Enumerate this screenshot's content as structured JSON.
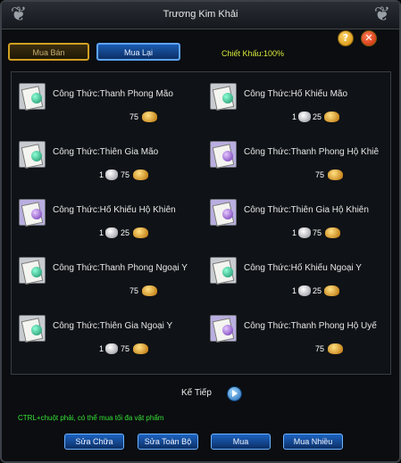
{
  "window": {
    "title": "Trương Kim Khải"
  },
  "tabs": [
    {
      "label": "Mua Bán",
      "active": true
    },
    {
      "label": "Mua Lại",
      "active": false
    }
  ],
  "discount_text": "Chiết Khấu:100%",
  "header_buttons": {
    "help": "?",
    "close": "✕"
  },
  "items": [
    {
      "name": "Công Thức:Thanh Phong Mão",
      "icon": "recipe-scroll-green-icon",
      "silver": null,
      "gold": "75"
    },
    {
      "name": "Công Thức:Hổ Khiếu Mão",
      "icon": "recipe-scroll-green-icon",
      "silver": "1",
      "gold": "25"
    },
    {
      "name": "Công Thức:Thiên Gia Mão",
      "icon": "recipe-scroll-green-icon",
      "silver": "1",
      "gold": "75"
    },
    {
      "name": "Công Thức:Thanh Phong Hộ Khiê",
      "icon": "recipe-scroll-purple-icon",
      "silver": null,
      "gold": "75"
    },
    {
      "name": "Công Thức:Hổ Khiếu Hộ Khiên",
      "icon": "recipe-scroll-purple-icon",
      "silver": "1",
      "gold": "25"
    },
    {
      "name": "Công Thức:Thiên Gia Hộ Khiên",
      "icon": "recipe-scroll-purple-icon",
      "silver": "1",
      "gold": "75"
    },
    {
      "name": "Công Thức:Thanh Phong Ngoại Y",
      "icon": "recipe-scroll-green-icon",
      "silver": null,
      "gold": "75"
    },
    {
      "name": "Công Thức:Hổ Khiếu Ngoại Y",
      "icon": "recipe-scroll-green-icon",
      "silver": "1",
      "gold": "25"
    },
    {
      "name": "Công Thức:Thiên Gia Ngoại Y",
      "icon": "recipe-scroll-green-icon",
      "silver": "1",
      "gold": "75"
    },
    {
      "name": "Công Thức:Thanh Phong Hộ Uyể",
      "icon": "recipe-scroll-purple-icon",
      "silver": null,
      "gold": "75"
    }
  ],
  "pagination": {
    "next_label": "Kế Tiếp"
  },
  "hint": "CTRL+chuột phải, có thể mua tối đa vật phẩm",
  "bottom_buttons": [
    "Sửa Chữa",
    "Sửa Toàn Bộ",
    "Mua",
    "Mua Nhiều"
  ]
}
